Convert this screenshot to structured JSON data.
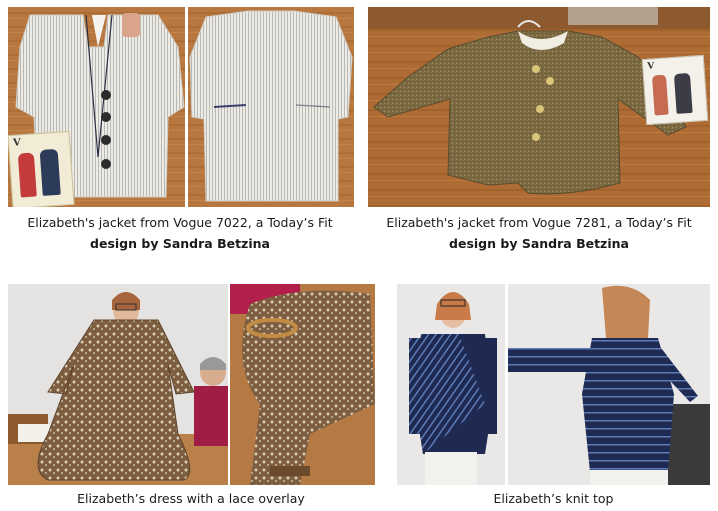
{
  "captions": {
    "top_left": {
      "line1": "Elizabeth's jacket from Vogue 7022, a Today’s Fit",
      "line2": "design by Sandra Betzina"
    },
    "top_right": {
      "line1": "Elizabeth's jacket from Vogue 7281, a Today’s Fit",
      "line2": "design by Sandra Betzina"
    },
    "bottom_left": {
      "line1": "Elizabeth’s dress with a lace overlay"
    },
    "bottom_right": {
      "line1": "Elizabeth’s knit top"
    }
  },
  "pattern_envelopes": {
    "vogue_7022_brand": "V",
    "vogue_7281_brand": "V"
  },
  "colors": {
    "table_wood": "#b5763f",
    "striped_jacket": "#e7e5e0",
    "tweed_jacket": "#7a6840",
    "lace_dress": "#8a6a4a",
    "navy_top": "#1f2a52",
    "wall": "#e8e6e3"
  }
}
